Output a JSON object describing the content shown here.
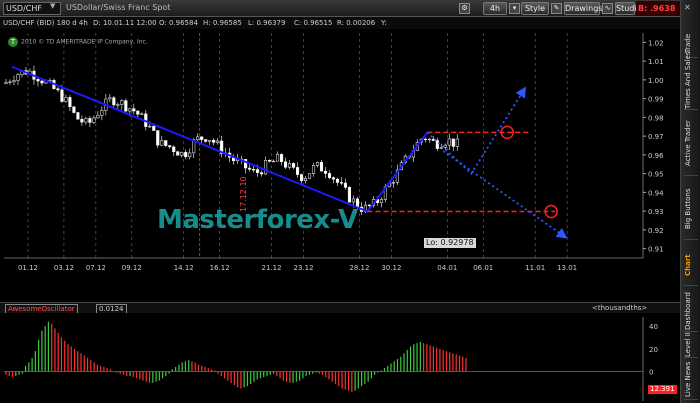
{
  "toolbar": {
    "symbol": "USD/CHF",
    "description": "USDollar/Swiss Franc Spot",
    "timeframe": "4h",
    "style_label": "Style",
    "drawings_label": "Drawings",
    "studies_label": "Studies",
    "price_label": "B: .9638"
  },
  "infobar": {
    "series": "USD/CHF (BID) 180 d 4h",
    "date": "D: 10.01.11 12:00",
    "open": "O: 0.96584",
    "high": "H: 0.96585",
    "low": "L: 0.96379",
    "close": "C: 0.96515",
    "range": "R: 0.00206",
    "y": "Y:"
  },
  "copyright": "2010 © TD AMERITRADE IP Company, Inc.",
  "watermark": "Masterforex-V",
  "low_label": "Lo: 0.92978",
  "vertical_date": "17.12.10",
  "sidebar_tabs": [
    "Trade",
    "Times And Sales",
    "Active Trader",
    "Big Buttons",
    "Chart",
    "Dashboard",
    "Level II",
    "Live News"
  ],
  "active_tab": "Chart",
  "oscillator": {
    "name": "AwesomeOscillator",
    "value": "0.0124",
    "units": "<thousandths>",
    "last_value": "12.391"
  },
  "colors": {
    "bullish_candle": "#ffffff",
    "bearish_candle": "#ffffff",
    "trendline": "#1a1aff",
    "projection": "#2a5aff",
    "level_line": "#ff2020",
    "osc_up": "#3ec83e",
    "osc_down": "#ff3030",
    "grid": "#6a6a6a",
    "watermark": "#178c8c",
    "icon_gear": "#888888"
  },
  "chart_data": [
    {
      "type": "candlestick",
      "title": "USD/CHF (BID) 180 d 4h",
      "x_ticks": [
        "01.12",
        "03.12",
        "07.12",
        "09.12",
        "14.12",
        "16.12",
        "21.12",
        "23.12",
        "28.12",
        "30.12",
        "04.01",
        "06.01",
        "11.01",
        "13.01"
      ],
      "y_ticks": [
        0.91,
        0.92,
        0.93,
        0.94,
        0.95,
        0.96,
        0.97,
        0.98,
        0.99,
        1.0,
        1.01,
        1.02
      ],
      "ylim": [
        0.905,
        1.025
      ],
      "close_path": [
        {
          "x": 0,
          "y": 0.998
        },
        {
          "x": 3,
          "y": 1.003
        },
        {
          "x": 6,
          "y": 1.005
        },
        {
          "x": 9,
          "y": 1.001
        },
        {
          "x": 12,
          "y": 0.996
        },
        {
          "x": 15,
          "y": 0.99
        },
        {
          "x": 18,
          "y": 0.98
        },
        {
          "x": 21,
          "y": 0.976
        },
        {
          "x": 24,
          "y": 0.984
        },
        {
          "x": 27,
          "y": 0.99
        },
        {
          "x": 30,
          "y": 0.987
        },
        {
          "x": 33,
          "y": 0.983
        },
        {
          "x": 36,
          "y": 0.976
        },
        {
          "x": 39,
          "y": 0.966
        },
        {
          "x": 42,
          "y": 0.964
        },
        {
          "x": 45,
          "y": 0.96
        },
        {
          "x": 48,
          "y": 0.968
        },
        {
          "x": 51,
          "y": 0.97
        },
        {
          "x": 54,
          "y": 0.964
        },
        {
          "x": 57,
          "y": 0.958
        },
        {
          "x": 60,
          "y": 0.954
        },
        {
          "x": 63,
          "y": 0.95
        },
        {
          "x": 66,
          "y": 0.955
        },
        {
          "x": 69,
          "y": 0.958
        },
        {
          "x": 72,
          "y": 0.952
        },
        {
          "x": 75,
          "y": 0.948
        },
        {
          "x": 78,
          "y": 0.954
        },
        {
          "x": 81,
          "y": 0.952
        },
        {
          "x": 84,
          "y": 0.944
        },
        {
          "x": 87,
          "y": 0.936
        },
        {
          "x": 90,
          "y": 0.931
        },
        {
          "x": 93,
          "y": 0.934
        },
        {
          "x": 96,
          "y": 0.943
        },
        {
          "x": 99,
          "y": 0.952
        },
        {
          "x": 102,
          "y": 0.962
        },
        {
          "x": 105,
          "y": 0.97
        },
        {
          "x": 108,
          "y": 0.966
        },
        {
          "x": 111,
          "y": 0.968
        },
        {
          "x": 114,
          "y": 0.965
        }
      ],
      "x_max": 160,
      "trend_down": [
        {
          "x": 2,
          "y": 1.007
        },
        {
          "x": 91,
          "y": 0.9298
        }
      ],
      "trend_up": [
        {
          "x": 91,
          "y": 0.9298
        },
        {
          "x": 106,
          "y": 0.972
        }
      ],
      "resistance": {
        "y": 0.972,
        "x_start": 106,
        "x_end": 132
      },
      "support": {
        "y": 0.9298,
        "x_start": 91,
        "x_end": 138
      },
      "projection_up": [
        {
          "x": 106,
          "y": 0.972
        },
        {
          "x": 117,
          "y": 0.95
        },
        {
          "x": 130,
          "y": 0.994
        }
      ],
      "projection_down": [
        {
          "x": 110,
          "y": 0.962
        },
        {
          "x": 140,
          "y": 0.917
        }
      ],
      "circles": [
        {
          "x": 126,
          "y": 0.972
        },
        {
          "x": 137,
          "y": 0.9298
        }
      ],
      "vertical_marker_x": 49
    },
    {
      "type": "bar",
      "title": "AwesomeOscillator",
      "y_ticks": [
        40,
        20,
        0
      ],
      "ylim": [
        -26,
        48
      ],
      "values": [
        -3,
        -4,
        -5,
        -4,
        -3,
        -2,
        5,
        8,
        12,
        18,
        28,
        36,
        40,
        44,
        42,
        38,
        34,
        30,
        27,
        24,
        22,
        20,
        18,
        16,
        14,
        12,
        10,
        8,
        6,
        5,
        4,
        3,
        2,
        0,
        -1,
        -2,
        -3,
        -4,
        -4,
        -5,
        -6,
        -7,
        -8,
        -9,
        -10,
        -10,
        -9,
        -8,
        -6,
        -4,
        -2,
        2,
        4,
        6,
        8,
        9,
        10,
        9,
        8,
        6,
        5,
        4,
        3,
        2,
        1,
        -2,
        -4,
        -6,
        -8,
        -10,
        -12,
        -14,
        -15,
        -14,
        -13,
        -11,
        -9,
        -7,
        -6,
        -5,
        -4,
        -3,
        -2,
        -4,
        -6,
        -8,
        -9,
        -10,
        -10,
        -9,
        -8,
        -6,
        -4,
        -3,
        -2,
        -1,
        -2,
        -3,
        -5,
        -7,
        -9,
        -11,
        -13,
        -15,
        -16,
        -17,
        -18,
        -17,
        -15,
        -13,
        -11,
        -9,
        -6,
        -3,
        -1,
        1,
        3,
        5,
        7,
        9,
        11,
        13,
        16,
        19,
        22,
        24,
        25,
        26,
        25,
        24,
        23,
        22,
        21,
        20,
        19,
        18,
        17,
        16,
        15,
        14,
        13,
        12
      ]
    }
  ]
}
